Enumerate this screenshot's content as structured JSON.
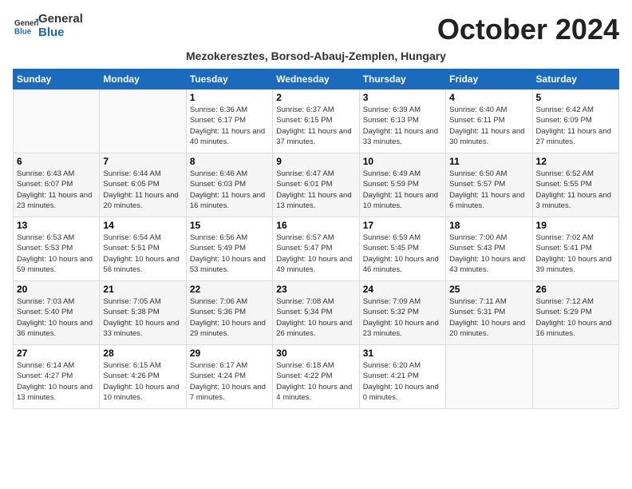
{
  "logo": {
    "general": "General",
    "blue": "Blue"
  },
  "title": "October 2024",
  "subtitle": "Mezokeresztes, Borsod-Abauj-Zemplen, Hungary",
  "days_header": [
    "Sunday",
    "Monday",
    "Tuesday",
    "Wednesday",
    "Thursday",
    "Friday",
    "Saturday"
  ],
  "weeks": [
    [
      {
        "day": "",
        "info": ""
      },
      {
        "day": "",
        "info": ""
      },
      {
        "day": "1",
        "info": "Sunrise: 6:36 AM\nSunset: 6:17 PM\nDaylight: 11 hours and 40 minutes."
      },
      {
        "day": "2",
        "info": "Sunrise: 6:37 AM\nSunset: 6:15 PM\nDaylight: 11 hours and 37 minutes."
      },
      {
        "day": "3",
        "info": "Sunrise: 6:39 AM\nSunset: 6:13 PM\nDaylight: 11 hours and 33 minutes."
      },
      {
        "day": "4",
        "info": "Sunrise: 6:40 AM\nSunset: 6:11 PM\nDaylight: 11 hours and 30 minutes."
      },
      {
        "day": "5",
        "info": "Sunrise: 6:42 AM\nSunset: 6:09 PM\nDaylight: 11 hours and 27 minutes."
      }
    ],
    [
      {
        "day": "6",
        "info": "Sunrise: 6:43 AM\nSunset: 6:07 PM\nDaylight: 11 hours and 23 minutes."
      },
      {
        "day": "7",
        "info": "Sunrise: 6:44 AM\nSunset: 6:05 PM\nDaylight: 11 hours and 20 minutes."
      },
      {
        "day": "8",
        "info": "Sunrise: 6:46 AM\nSunset: 6:03 PM\nDaylight: 11 hours and 16 minutes."
      },
      {
        "day": "9",
        "info": "Sunrise: 6:47 AM\nSunset: 6:01 PM\nDaylight: 11 hours and 13 minutes."
      },
      {
        "day": "10",
        "info": "Sunrise: 6:49 AM\nSunset: 5:59 PM\nDaylight: 11 hours and 10 minutes."
      },
      {
        "day": "11",
        "info": "Sunrise: 6:50 AM\nSunset: 5:57 PM\nDaylight: 11 hours and 6 minutes."
      },
      {
        "day": "12",
        "info": "Sunrise: 6:52 AM\nSunset: 5:55 PM\nDaylight: 11 hours and 3 minutes."
      }
    ],
    [
      {
        "day": "13",
        "info": "Sunrise: 6:53 AM\nSunset: 5:53 PM\nDaylight: 10 hours and 59 minutes."
      },
      {
        "day": "14",
        "info": "Sunrise: 6:54 AM\nSunset: 5:51 PM\nDaylight: 10 hours and 56 minutes."
      },
      {
        "day": "15",
        "info": "Sunrise: 6:56 AM\nSunset: 5:49 PM\nDaylight: 10 hours and 53 minutes."
      },
      {
        "day": "16",
        "info": "Sunrise: 6:57 AM\nSunset: 5:47 PM\nDaylight: 10 hours and 49 minutes."
      },
      {
        "day": "17",
        "info": "Sunrise: 6:59 AM\nSunset: 5:45 PM\nDaylight: 10 hours and 46 minutes."
      },
      {
        "day": "18",
        "info": "Sunrise: 7:00 AM\nSunset: 5:43 PM\nDaylight: 10 hours and 43 minutes."
      },
      {
        "day": "19",
        "info": "Sunrise: 7:02 AM\nSunset: 5:41 PM\nDaylight: 10 hours and 39 minutes."
      }
    ],
    [
      {
        "day": "20",
        "info": "Sunrise: 7:03 AM\nSunset: 5:40 PM\nDaylight: 10 hours and 36 minutes."
      },
      {
        "day": "21",
        "info": "Sunrise: 7:05 AM\nSunset: 5:38 PM\nDaylight: 10 hours and 33 minutes."
      },
      {
        "day": "22",
        "info": "Sunrise: 7:06 AM\nSunset: 5:36 PM\nDaylight: 10 hours and 29 minutes."
      },
      {
        "day": "23",
        "info": "Sunrise: 7:08 AM\nSunset: 5:34 PM\nDaylight: 10 hours and 26 minutes."
      },
      {
        "day": "24",
        "info": "Sunrise: 7:09 AM\nSunset: 5:32 PM\nDaylight: 10 hours and 23 minutes."
      },
      {
        "day": "25",
        "info": "Sunrise: 7:11 AM\nSunset: 5:31 PM\nDaylight: 10 hours and 20 minutes."
      },
      {
        "day": "26",
        "info": "Sunrise: 7:12 AM\nSunset: 5:29 PM\nDaylight: 10 hours and 16 minutes."
      }
    ],
    [
      {
        "day": "27",
        "info": "Sunrise: 6:14 AM\nSunset: 4:27 PM\nDaylight: 10 hours and 13 minutes."
      },
      {
        "day": "28",
        "info": "Sunrise: 6:15 AM\nSunset: 4:26 PM\nDaylight: 10 hours and 10 minutes."
      },
      {
        "day": "29",
        "info": "Sunrise: 6:17 AM\nSunset: 4:24 PM\nDaylight: 10 hours and 7 minutes."
      },
      {
        "day": "30",
        "info": "Sunrise: 6:18 AM\nSunset: 4:22 PM\nDaylight: 10 hours and 4 minutes."
      },
      {
        "day": "31",
        "info": "Sunrise: 6:20 AM\nSunset: 4:21 PM\nDaylight: 10 hours and 0 minutes."
      },
      {
        "day": "",
        "info": ""
      },
      {
        "day": "",
        "info": ""
      }
    ]
  ]
}
